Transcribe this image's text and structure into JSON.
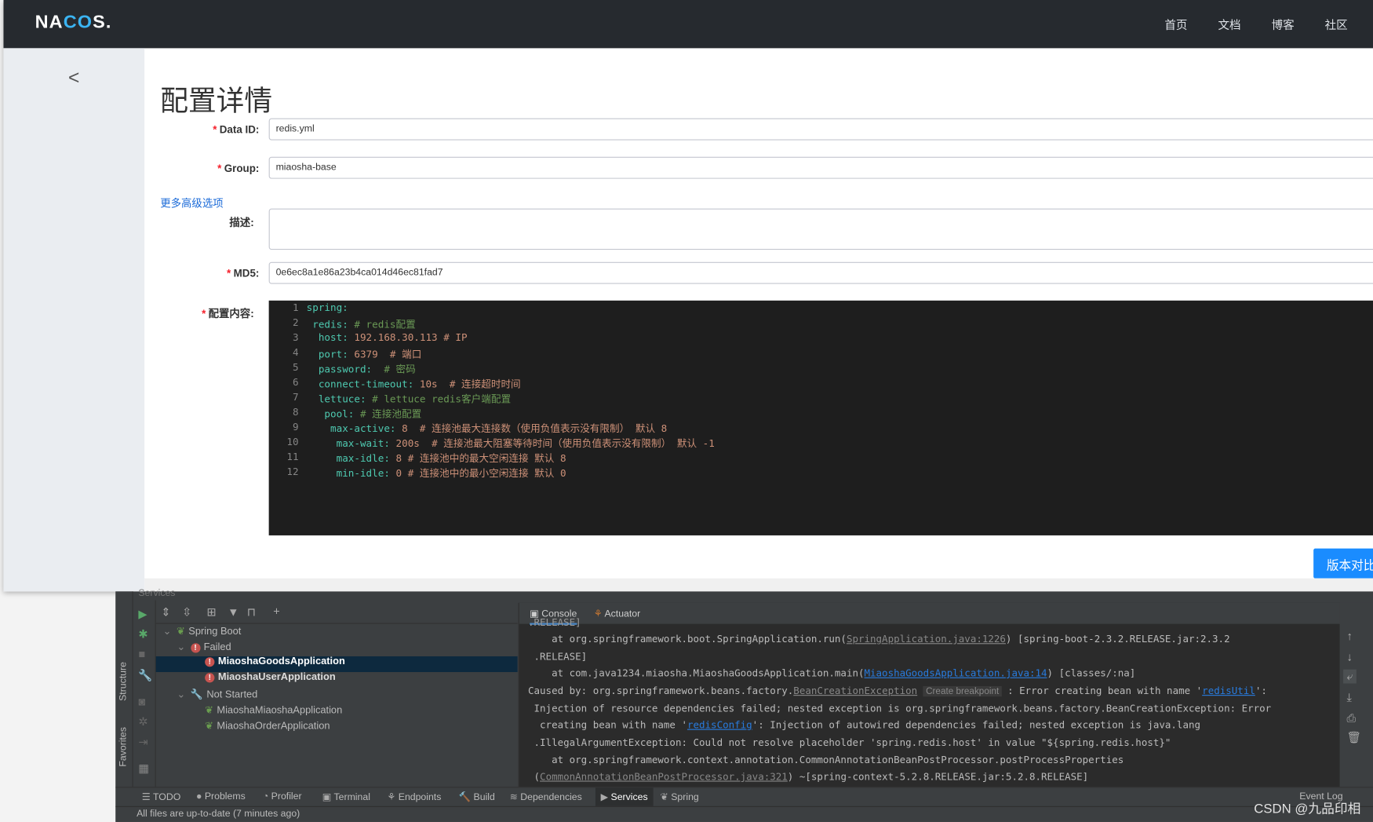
{
  "nav": {
    "logo_text": "NACOS.",
    "links": [
      "首页",
      "文档",
      "博客",
      "社区"
    ]
  },
  "page": {
    "title": "配置详情",
    "more_options": "更多高级选项",
    "compare_button": "版本对比"
  },
  "form": {
    "data_id": {
      "label": "Data ID:",
      "value": "redis.yml"
    },
    "group": {
      "label": "Group:",
      "value": "miaosha-base"
    },
    "description": {
      "label": "描述:",
      "value": ""
    },
    "md5": {
      "label": "MD5:",
      "value": "0e6ec8a1e86a23b4ca014d46ec81fad7"
    },
    "content": {
      "label": "配置内容:"
    }
  },
  "code_lines": [
    {
      "indent": "",
      "key": "spring:",
      "val": "",
      "comment": ""
    },
    {
      "indent": " ",
      "key": "redis:",
      "val": "",
      "comment": " # redis配置"
    },
    {
      "indent": "  ",
      "key": "host:",
      "val": " 192.168.30.113 # IP",
      "comment": ""
    },
    {
      "indent": "  ",
      "key": "port:",
      "val": " 6379  # 端口",
      "comment": ""
    },
    {
      "indent": "  ",
      "key": "password:",
      "val": "",
      "comment": "  # 密码"
    },
    {
      "indent": "  ",
      "key": "connect-timeout:",
      "val": " 10s  # 连接超时时间",
      "comment": ""
    },
    {
      "indent": "  ",
      "key": "lettuce:",
      "val": "",
      "comment": " # lettuce redis客户端配置"
    },
    {
      "indent": "   ",
      "key": "pool:",
      "val": "",
      "comment": " # 连接池配置"
    },
    {
      "indent": "    ",
      "key": "max-active:",
      "val": " 8  # 连接池最大连接数（使用负值表示没有限制） 默认 8",
      "comment": ""
    },
    {
      "indent": "     ",
      "key": "max-wait:",
      "val": " 200s  # 连接池最大阻塞等待时间（使用负值表示没有限制） 默认 -1",
      "comment": ""
    },
    {
      "indent": "     ",
      "key": "max-idle:",
      "val": " 8 # 连接池中的最大空闲连接 默认 8",
      "comment": ""
    },
    {
      "indent": "     ",
      "key": "min-idle:",
      "val": " 0 # 连接池中的最小空闲连接 默认 0",
      "comment": ""
    }
  ],
  "ide": {
    "panel_title": "Services",
    "side_tabs": [
      "Structure",
      "Favorites"
    ],
    "tree": [
      {
        "label": "Spring Boot",
        "type": "group"
      },
      {
        "label": "Failed",
        "type": "status-failed"
      },
      {
        "label": "MiaoshaGoodsApplication",
        "type": "failed-app",
        "selected": true
      },
      {
        "label": "MiaoshaUserApplication",
        "type": "failed-app"
      },
      {
        "label": "Not Started",
        "type": "status-notstarted"
      },
      {
        "label": "MiaoshaMiaoshaApplication",
        "type": "app"
      },
      {
        "label": "MiaoshaOrderApplication",
        "type": "app"
      }
    ],
    "console_tabs": [
      "Console",
      "Actuator"
    ],
    "console": {
      "l0": ".RELEASE]",
      "l1a": "    at org.springframework.boot.SpringApplication.run(",
      "l1link": "SpringApplication.java:1226",
      "l1b": ") [spring-boot-2.3.2.RELEASE.jar:2.3.2",
      "l2": " .RELEASE]",
      "l3a": "    at com.java1234.miaosha.MiaoshaGoodsApplication.main(",
      "l3link": "MiaoshaGoodsApplication.java:14",
      "l3b": ") [classes/:na]",
      "l4a": "Caused by: org.springframework.beans.factory.",
      "l4link": "BeanCreationException",
      "l4hint": "Create breakpoint",
      "l4b": " : Error creating bean with name '",
      "l4link2": "redisUtil",
      "l4c": "':",
      "l5": " Injection of resource dependencies failed; nested exception is org.springframework.beans.factory.BeanCreationException: Error",
      "l6a": "  creating bean with name '",
      "l6link": "redisConfig",
      "l6b": "': Injection of autowired dependencies failed; nested exception is java.lang",
      "l7": " .IllegalArgumentException: Could not resolve placeholder 'spring.redis.host' in value \"${spring.redis.host}\"",
      "l8": "    at org.springframework.context.annotation.CommonAnnotationBeanPostProcessor.postProcessProperties",
      "l9a": " (",
      "l9link": "CommonAnnotationBeanPostProcessor.java:321",
      "l9b": ") ~[spring-context-5.2.8.RELEASE.jar:5.2.8.RELEASE]"
    },
    "bottom_tabs": [
      "TODO",
      "Problems",
      "Profiler",
      "Terminal",
      "Endpoints",
      "Build",
      "Dependencies",
      "Services",
      "Spring"
    ],
    "event_log": "Event Log",
    "status": "All files are up-to-date (7 minutes ago)"
  },
  "watermark": "CSDN @九品印相"
}
